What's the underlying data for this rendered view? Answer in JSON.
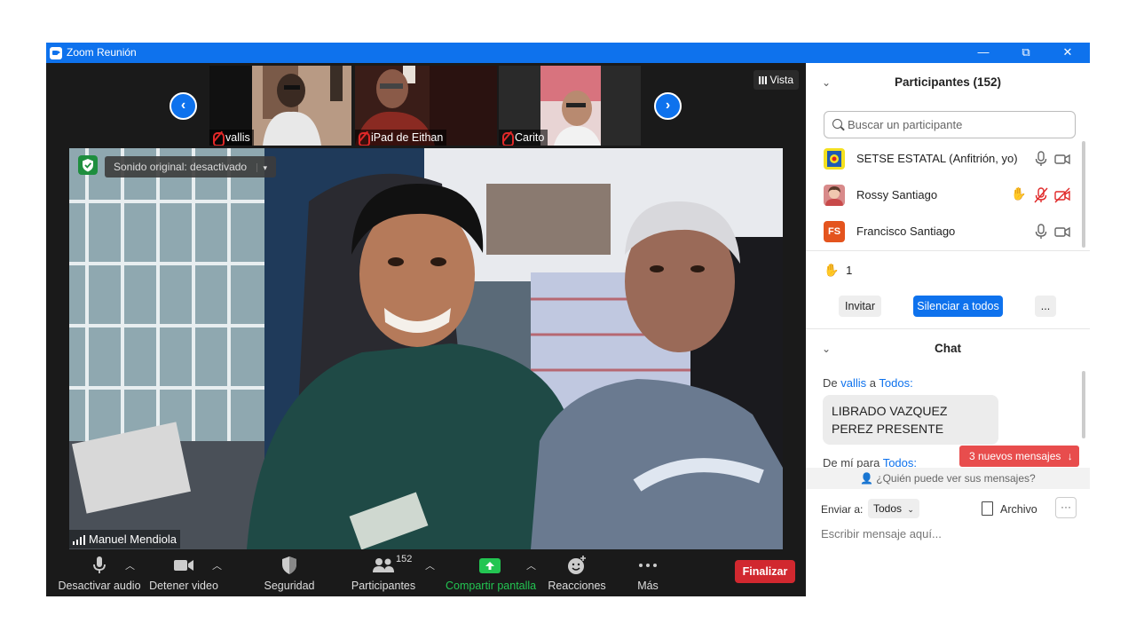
{
  "window": {
    "title": "Zoom Reunión",
    "controls": {
      "minimize": "—",
      "restore": "⧉",
      "close": "✕"
    }
  },
  "thumbnails": [
    {
      "name": "vallis"
    },
    {
      "name": "iPad de Eithan"
    },
    {
      "name": "Carito"
    }
  ],
  "view_button": "Vista",
  "main_video": {
    "original_sound": "Sonido original: desactivado",
    "speaker": "Manuel Mendiola"
  },
  "toolbar": {
    "mute": "Desactivar audio",
    "video": "Detener video",
    "security": "Seguridad",
    "participants": "Participantes",
    "participant_count": "152",
    "share": "Compartir pantalla",
    "reactions": "Reacciones",
    "more": "Más",
    "end": "Finalizar"
  },
  "participants_panel": {
    "title": "Participantes (152)",
    "search_placeholder": "Buscar un participante",
    "list": [
      {
        "name": "SETSE ESTATAL (Anfitrión, yo)"
      },
      {
        "name": "Rossy Santiago"
      },
      {
        "name": "Francisco Santiago",
        "initials": "FS"
      }
    ],
    "raised_hands": "1",
    "invite": "Invitar",
    "mute_all": "Silenciar a todos",
    "more": "..."
  },
  "chat": {
    "title": "Chat",
    "msg1": {
      "from_prefix": "De",
      "sender": "vallis",
      "to_prefix": "a",
      "recipient": "Todos:",
      "text": "LIBRADO VAZQUEZ PEREZ PRESENTE"
    },
    "msg2": {
      "from_prefix": "De mí para",
      "recipient": "Todos:"
    },
    "new_messages": "3 nuevos mensajes",
    "who_sees": "¿Quién puede ver sus mensajes?",
    "send_to_label": "Enviar a:",
    "send_to_value": "Todos",
    "file_button": "Archivo",
    "more": "···",
    "input_placeholder": "Escribir mensaje aquí..."
  },
  "colors": {
    "zoom_blue": "#0e72ed",
    "end_red": "#d1282f",
    "share_green": "#23c552",
    "mute_red": "#e02828"
  }
}
